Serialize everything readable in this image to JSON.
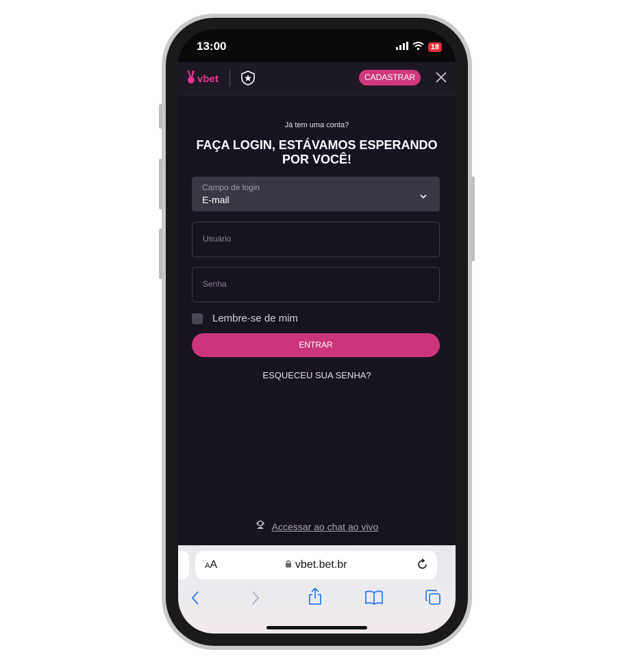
{
  "status": {
    "time": "13:00",
    "battery": "18"
  },
  "header": {
    "logo_text": "vbet",
    "register_label": "CADASTRAR"
  },
  "login": {
    "prompt": "Já tem uma conta?",
    "heading_line1": "FAÇA LOGIN, ESTÁVAMOS ESPERANDO",
    "heading_line2": "POR VOCÊ!",
    "select_label": "Campo de login",
    "select_value": "E-mail",
    "username_placeholder": "Usuário",
    "password_placeholder": "Senha",
    "remember_label": "Lembre-se de mim",
    "enter_label": "ENTRAR",
    "forgot_label": "ESQUECEU SUA SENHA?",
    "chat_label": "Accessar ao chat ao vivo"
  },
  "browser": {
    "aa_small": "A",
    "aa_big": "A",
    "url": "vbet.bet.br"
  },
  "colors": {
    "accent": "#d1387e",
    "background": "#17131f",
    "field_bg": "#3a3643"
  },
  "icons": [
    "signal-icon",
    "wifi-icon",
    "vbet-logo-icon",
    "crest-icon",
    "close-icon",
    "chevron-down-icon",
    "support-agent-icon",
    "lock-icon",
    "reload-icon",
    "back-icon",
    "forward-icon",
    "share-icon",
    "bookmarks-icon",
    "tabs-icon"
  ]
}
